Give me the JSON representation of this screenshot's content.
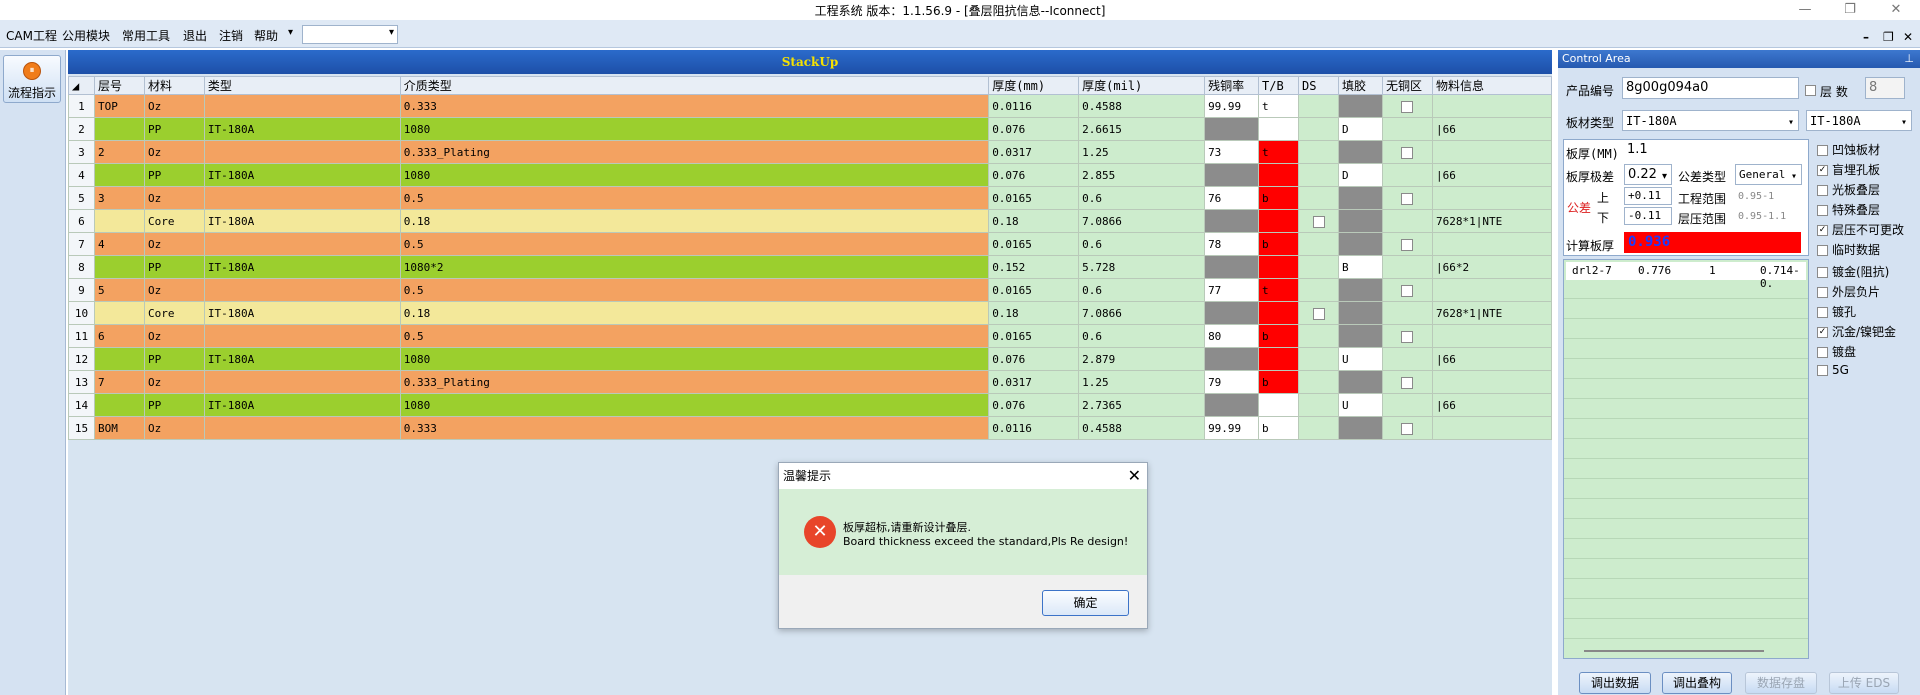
{
  "window": {
    "title": "工程系统   版本：1.1.56.9 - [叠层阻抗信息--Iconnect]"
  },
  "menu": {
    "items": [
      "CAM工程",
      "公用模块",
      "常用工具",
      "退出",
      "注销",
      "帮助"
    ],
    "help_arrow": "▾"
  },
  "leftpanel": {
    "flow_label": "流程指示"
  },
  "grid": {
    "title": "StackUp",
    "headers": [
      "层号",
      "材料",
      "类型",
      "介质类型",
      "厚度(mm)",
      "厚度(mil)",
      "残铜率",
      "T/B",
      "DS",
      "填胶",
      "无铜区",
      "物料信息"
    ],
    "rows": [
      {
        "n": "1",
        "layer": "TOP",
        "mat": "Oz",
        "type": "",
        "diel": "0.333",
        "mm": "0.0116",
        "mil": "0.4588",
        "cu": "99.99",
        "tb": "t",
        "ds": "",
        "fill": "",
        "nocu": true,
        "info": "",
        "color": "orange",
        "cuc": "white",
        "tbc": "white",
        "fillc": "gray",
        "dscb": false
      },
      {
        "n": "2",
        "layer": "",
        "mat": "PP",
        "type": "IT-180A",
        "diel": "1080",
        "mm": "0.076",
        "mil": "2.6615",
        "cu": "",
        "tb": "",
        "ds": "",
        "fill": "D",
        "nocu": false,
        "info": "|66",
        "color": "green",
        "cuc": "gray",
        "tbc": "white",
        "fillc": "white",
        "dscb": false
      },
      {
        "n": "3",
        "layer": "2",
        "mat": "Oz",
        "type": "",
        "diel": "0.333_Plating",
        "mm": "0.0317",
        "mil": "1.25",
        "cu": "73",
        "tb": "t",
        "ds": "",
        "fill": "",
        "nocu": true,
        "info": "",
        "color": "orange",
        "cuc": "white",
        "tbc": "red",
        "fillc": "gray",
        "dscb": false
      },
      {
        "n": "4",
        "layer": "",
        "mat": "PP",
        "type": "IT-180A",
        "diel": "1080",
        "mm": "0.076",
        "mil": "2.855",
        "cu": "",
        "tb": "",
        "ds": "",
        "fill": "D",
        "nocu": false,
        "info": "|66",
        "color": "green",
        "cuc": "gray",
        "tbc": "red",
        "fillc": "white",
        "dscb": false
      },
      {
        "n": "5",
        "layer": "3",
        "mat": "Oz",
        "type": "",
        "diel": "0.5",
        "mm": "0.0165",
        "mil": "0.6",
        "cu": "76",
        "tb": "b",
        "ds": "",
        "fill": "",
        "nocu": true,
        "info": "",
        "color": "orange",
        "cuc": "white",
        "tbc": "red",
        "fillc": "gray",
        "dscb": false
      },
      {
        "n": "6",
        "layer": "",
        "mat": "Core",
        "type": "IT-180A",
        "diel": "0.18",
        "mm": "0.18",
        "mil": "7.0866",
        "cu": "",
        "tb": "",
        "ds": "",
        "fill": "",
        "nocu": false,
        "info": "7628*1|NTE",
        "color": "yellow",
        "cuc": "gray",
        "tbc": "red",
        "fillc": "gray",
        "dscb": true
      },
      {
        "n": "7",
        "layer": "4",
        "mat": "Oz",
        "type": "",
        "diel": "0.5",
        "mm": "0.0165",
        "mil": "0.6",
        "cu": "78",
        "tb": "b",
        "ds": "",
        "fill": "",
        "nocu": true,
        "info": "",
        "color": "orange",
        "cuc": "white",
        "tbc": "red",
        "fillc": "gray",
        "dscb": false
      },
      {
        "n": "8",
        "layer": "",
        "mat": "PP",
        "type": "IT-180A",
        "diel": "1080*2",
        "mm": "0.152",
        "mil": "5.728",
        "cu": "",
        "tb": "",
        "ds": "",
        "fill": "B",
        "nocu": false,
        "info": "|66*2",
        "color": "green",
        "cuc": "gray",
        "tbc": "red",
        "fillc": "white",
        "dscb": false
      },
      {
        "n": "9",
        "layer": "5",
        "mat": "Oz",
        "type": "",
        "diel": "0.5",
        "mm": "0.0165",
        "mil": "0.6",
        "cu": "77",
        "tb": "t",
        "ds": "",
        "fill": "",
        "nocu": true,
        "info": "",
        "color": "orange",
        "cuc": "white",
        "tbc": "red",
        "fillc": "gray",
        "dscb": false
      },
      {
        "n": "10",
        "layer": "",
        "mat": "Core",
        "type": "IT-180A",
        "diel": "0.18",
        "mm": "0.18",
        "mil": "7.0866",
        "cu": "",
        "tb": "",
        "ds": "",
        "fill": "",
        "nocu": false,
        "info": "7628*1|NTE",
        "color": "yellow",
        "cuc": "gray",
        "tbc": "red",
        "fillc": "gray",
        "dscb": true
      },
      {
        "n": "11",
        "layer": "6",
        "mat": "Oz",
        "type": "",
        "diel": "0.5",
        "mm": "0.0165",
        "mil": "0.6",
        "cu": "80",
        "tb": "b",
        "ds": "",
        "fill": "",
        "nocu": true,
        "info": "",
        "color": "orange",
        "cuc": "white",
        "tbc": "red",
        "fillc": "gray",
        "dscb": false
      },
      {
        "n": "12",
        "layer": "",
        "mat": "PP",
        "type": "IT-180A",
        "diel": "1080",
        "mm": "0.076",
        "mil": "2.879",
        "cu": "",
        "tb": "",
        "ds": "",
        "fill": "U",
        "nocu": false,
        "info": "|66",
        "color": "green",
        "cuc": "gray",
        "tbc": "red",
        "fillc": "white",
        "dscb": false
      },
      {
        "n": "13",
        "layer": "7",
        "mat": "Oz",
        "type": "",
        "diel": "0.333_Plating",
        "mm": "0.0317",
        "mil": "1.25",
        "cu": "79",
        "tb": "b",
        "ds": "",
        "fill": "",
        "nocu": true,
        "info": "",
        "color": "orange",
        "cuc": "white",
        "tbc": "red",
        "fillc": "gray",
        "dscb": false
      },
      {
        "n": "14",
        "layer": "",
        "mat": "PP",
        "type": "IT-180A",
        "diel": "1080",
        "mm": "0.076",
        "mil": "2.7365",
        "cu": "",
        "tb": "",
        "ds": "",
        "fill": "U",
        "nocu": false,
        "info": "|66",
        "color": "green",
        "cuc": "gray",
        "tbc": "white",
        "fillc": "white",
        "dscb": false
      },
      {
        "n": "15",
        "layer": "BOM",
        "mat": "Oz",
        "type": "",
        "diel": "0.333",
        "mm": "0.0116",
        "mil": "0.4588",
        "cu": "99.99",
        "tb": "b",
        "ds": "",
        "fill": "",
        "nocu": true,
        "info": "",
        "color": "orange",
        "cuc": "white",
        "tbc": "white",
        "fillc": "gray",
        "dscb": false
      }
    ]
  },
  "control": {
    "title": "Control Area",
    "pin": "⊥",
    "product_label": "产品编号",
    "product_value": "8g00g094a0",
    "layer_count_label": "层 数",
    "layer_count": "8",
    "board_type_label": "板材类型",
    "board_type": "IT-180A",
    "board_type2": "IT-180A",
    "thick_label": "板厚(MM)",
    "thick_value": "1.1",
    "tol_label": "板厚极差",
    "tol_value": "0.22",
    "tol_type_label": "公差类型",
    "tol_type": "General",
    "gong_label": "公差",
    "up_label": "上",
    "down_label": "下",
    "up_value": "+0.11",
    "down_value": "-0.11",
    "eng_range_label": "工程范围",
    "eng_range": "0.95-1",
    "press_range_label": "层压范围",
    "press_range": "0.95-1.1",
    "calc_label": "计算板厚",
    "calc_value": "0.936",
    "drl": {
      "name": "drl2-7",
      "v1": "0.776",
      "v2": "1",
      "v3": "0.714-0."
    },
    "checks": [
      {
        "label": "凹蚀板材",
        "checked": false
      },
      {
        "label": "盲埋孔板",
        "checked": true
      },
      {
        "label": "光板叠层",
        "checked": false
      },
      {
        "label": "特殊叠层",
        "checked": false
      },
      {
        "label": "层压不可更改",
        "checked": true
      },
      {
        "label": "临时数据",
        "checked": false
      },
      {
        "label": "镀金(阻抗)",
        "checked": false
      },
      {
        "label": "外层负片",
        "checked": false
      },
      {
        "label": "镀孔",
        "checked": false
      },
      {
        "label": "沉金/镍钯金",
        "checked": true
      },
      {
        "label": "镀盘",
        "checked": false
      },
      {
        "label": "5G",
        "checked": false
      }
    ],
    "buttons": [
      "调出数据",
      "调出叠构",
      "数据存盘",
      "上传 EDS"
    ]
  },
  "dialog": {
    "title": "温馨提示",
    "message_cn": "板厚超标,请重新设计叠层.",
    "message_en": "Board thickness exceed the standard,Pls Re design!",
    "ok": "确定"
  }
}
